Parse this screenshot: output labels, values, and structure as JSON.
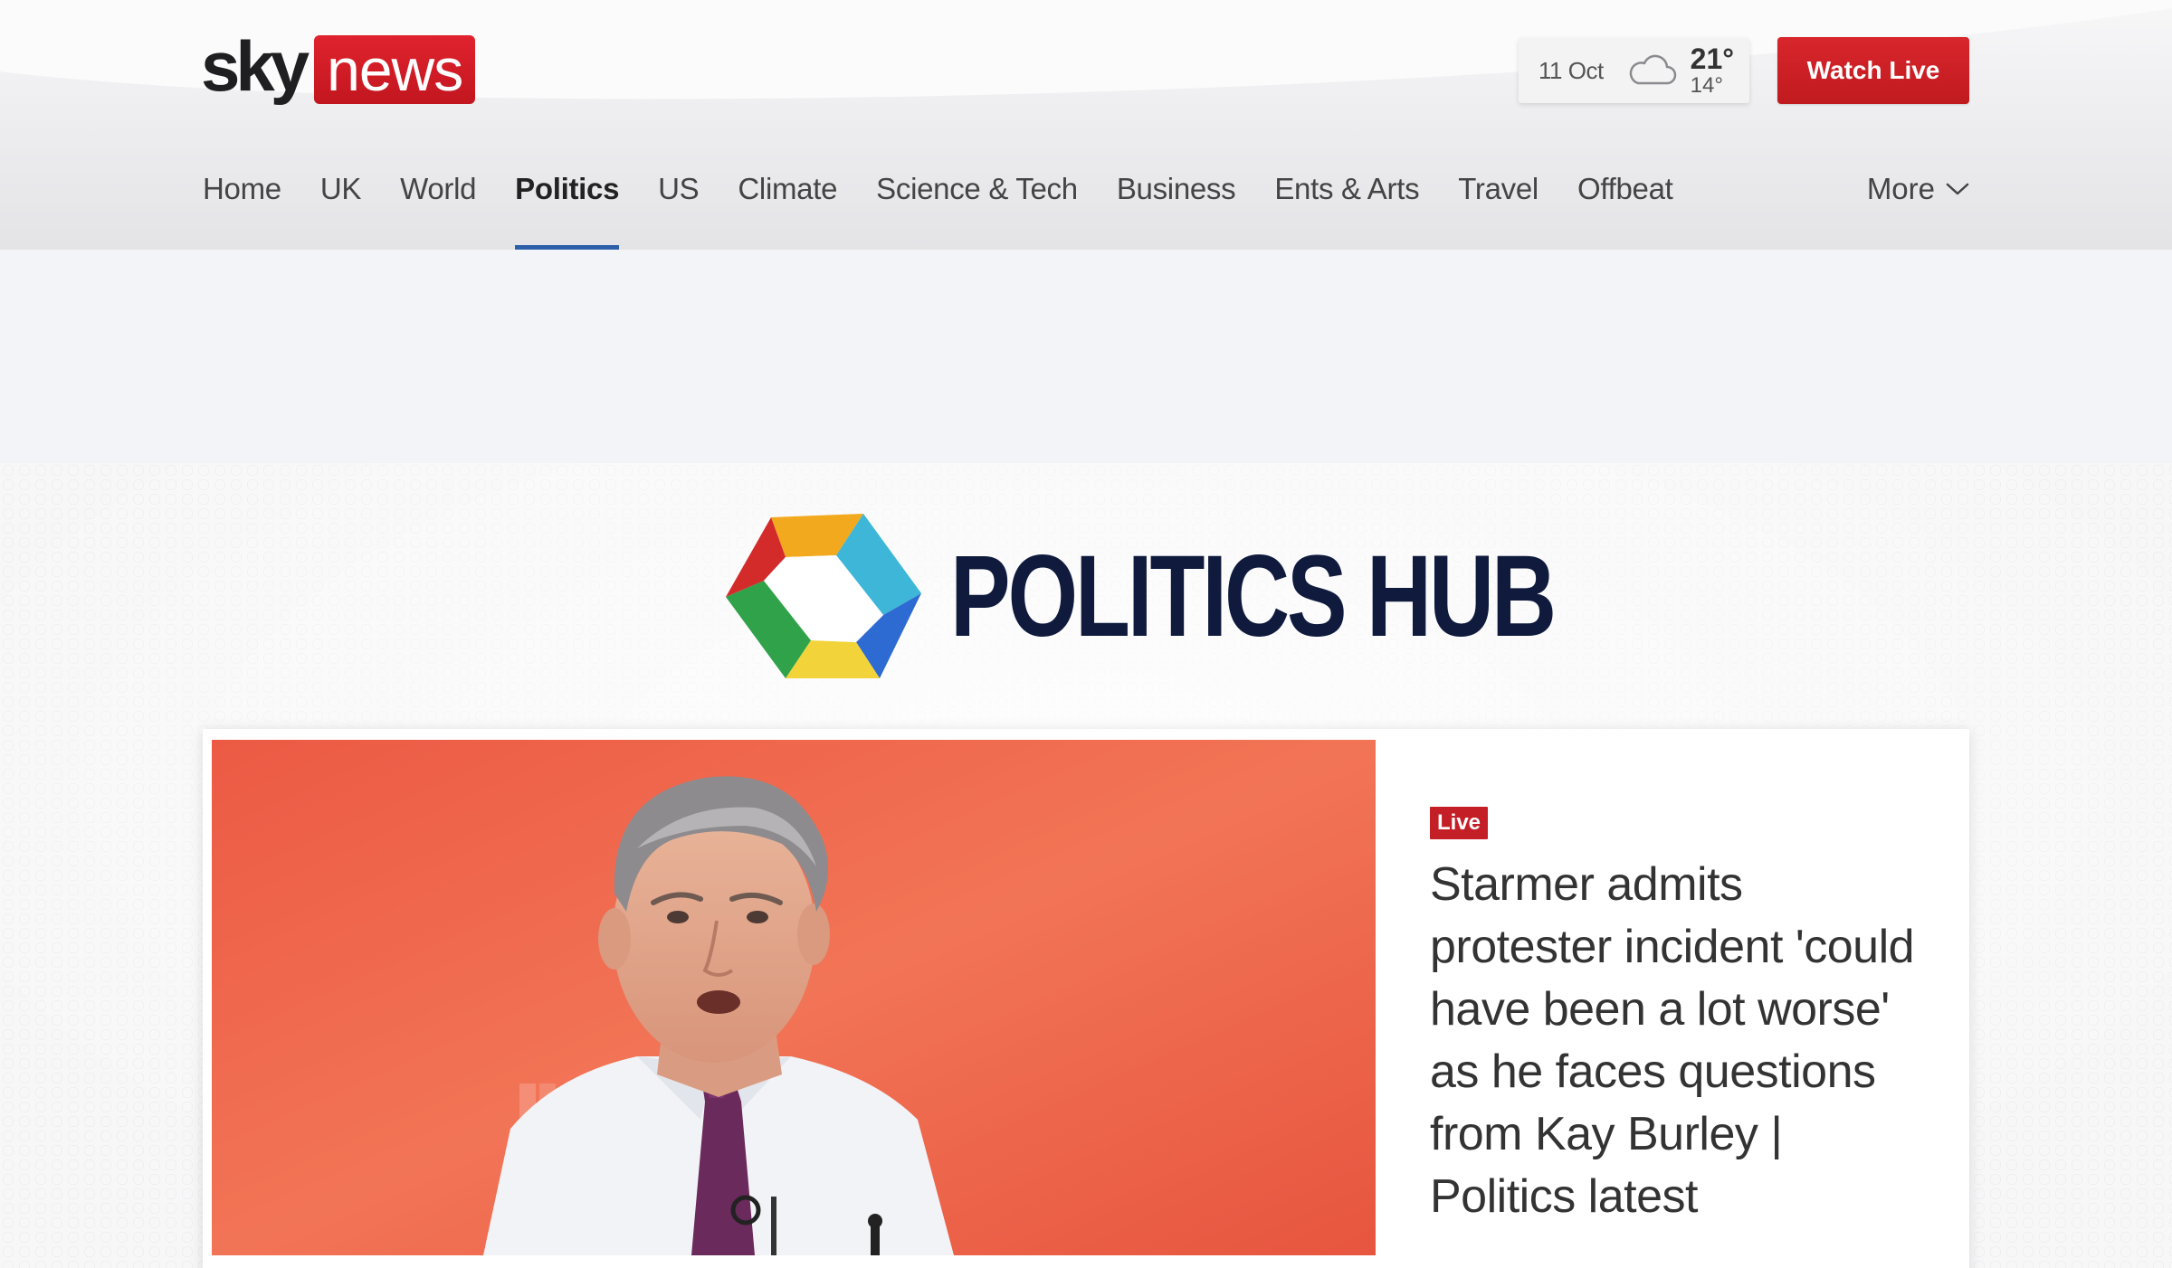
{
  "brand": {
    "logo_left": "sky",
    "logo_right": "news"
  },
  "weather": {
    "date": "11 Oct",
    "icon": "cloud-icon",
    "high": "21°",
    "low": "14°"
  },
  "header": {
    "watch_live_label": "Watch Live"
  },
  "nav": {
    "items": [
      {
        "label": "Home"
      },
      {
        "label": "UK"
      },
      {
        "label": "World"
      },
      {
        "label": "Politics",
        "active": true
      },
      {
        "label": "US"
      },
      {
        "label": "Climate"
      },
      {
        "label": "Science & Tech"
      },
      {
        "label": "Business"
      },
      {
        "label": "Ents & Arts"
      },
      {
        "label": "Travel"
      },
      {
        "label": "Offbeat"
      }
    ],
    "more_label": "More"
  },
  "hub": {
    "title": "POLITICS HUB"
  },
  "lead_story": {
    "badge": "Live",
    "headline": "Starmer admits protester incident 'could have been a lot worse' as he faces questions from Kay Burley | Politics latest"
  },
  "colors": {
    "brand_red": "#c41e26",
    "nav_active_underline": "#2c5eaa",
    "hub_navy": "#0f1a3d"
  }
}
